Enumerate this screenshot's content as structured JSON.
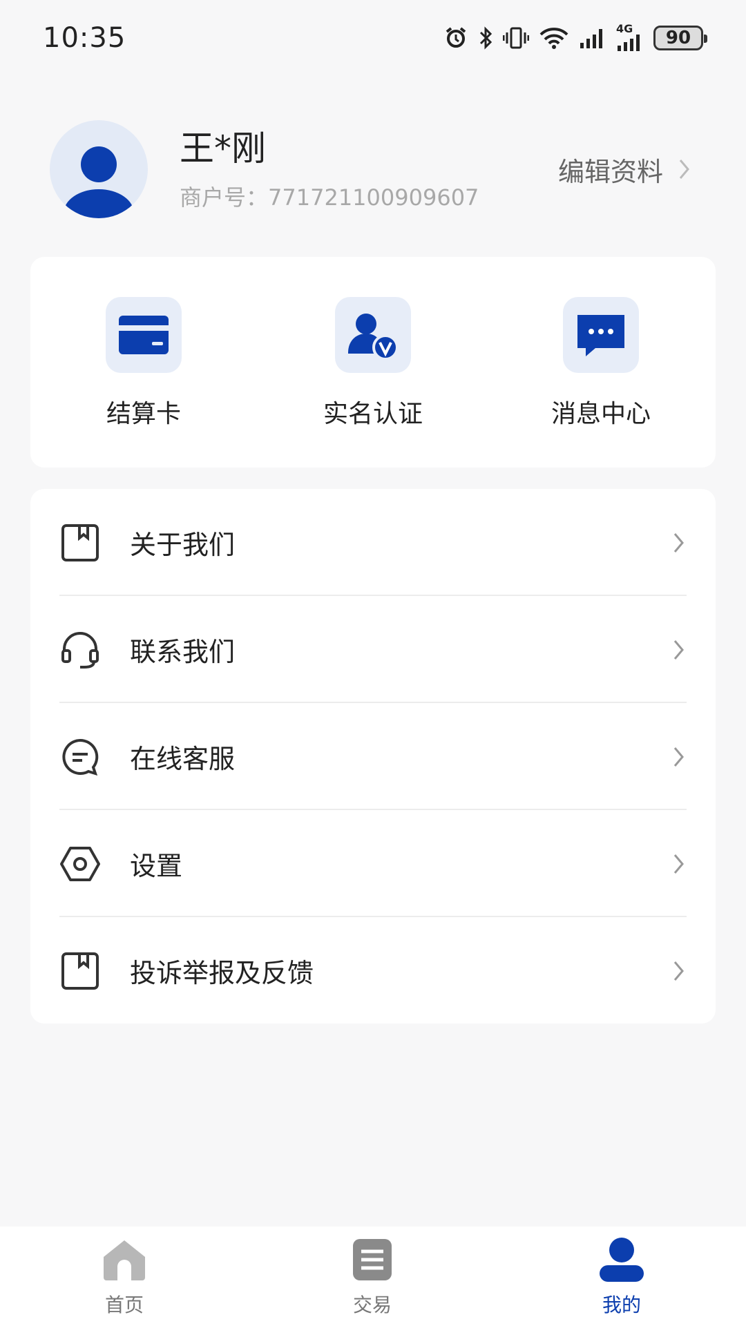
{
  "status_bar": {
    "time": "10:35",
    "network": "4G",
    "battery": "90",
    "icons": [
      "alarm-icon",
      "bluetooth-icon",
      "vibrate-icon",
      "wifi-icon",
      "signal-icon",
      "signal-4g-icon",
      "battery-icon"
    ]
  },
  "profile": {
    "name": "王*刚",
    "merchant_label": "商户号：",
    "merchant_id": "771721100909607",
    "edit_label": "编辑资料"
  },
  "quick_actions": [
    {
      "label": "结算卡",
      "icon": "bank-card-icon"
    },
    {
      "label": "实名认证",
      "icon": "verified-user-icon"
    },
    {
      "label": "消息中心",
      "icon": "message-icon"
    }
  ],
  "menu": [
    {
      "label": "关于我们",
      "icon": "about-icon"
    },
    {
      "label": "联系我们",
      "icon": "headset-icon"
    },
    {
      "label": "在线客服",
      "icon": "chat-icon"
    },
    {
      "label": "设置",
      "icon": "settings-icon"
    },
    {
      "label": "投诉举报及反馈",
      "icon": "feedback-icon"
    }
  ],
  "bottom_nav": {
    "tabs": [
      {
        "label": "首页",
        "icon": "home-icon",
        "active": false
      },
      {
        "label": "交易",
        "icon": "transaction-icon",
        "active": false
      },
      {
        "label": "我的",
        "icon": "profile-icon",
        "active": true
      }
    ]
  },
  "colors": {
    "accent": "#0c3eae",
    "icon_bg": "#e7edf8",
    "background": "#f7f7f8"
  }
}
